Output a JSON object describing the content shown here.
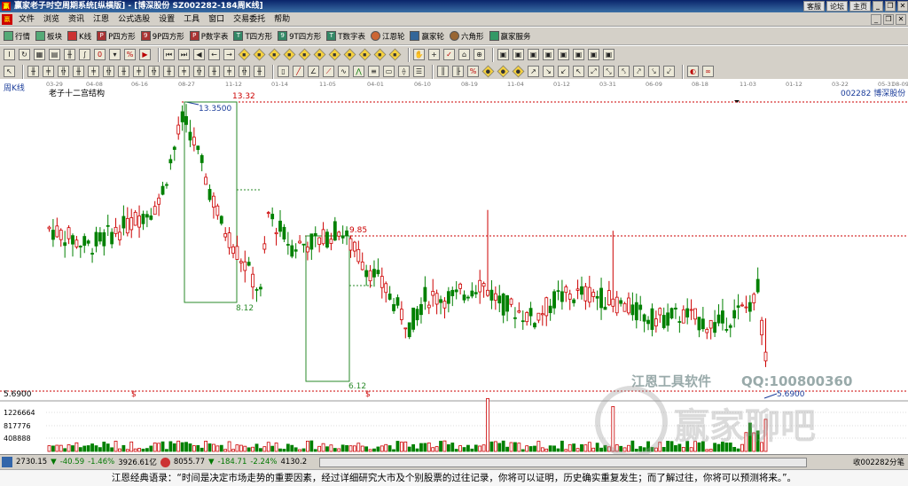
{
  "titlebar": {
    "app_logo": "赢",
    "title": "赢家老子时空周期系统[纵横版] - [博深股份  SZ002282-184周K线]",
    "links": [
      "客服",
      "论坛",
      "主页"
    ]
  },
  "menu": {
    "logo": "赢",
    "items": [
      "文件",
      "浏览",
      "资讯",
      "江恩",
      "公式选股",
      "设置",
      "工具",
      "窗口",
      "交易委托",
      "帮助"
    ]
  },
  "toolbar1": [
    {
      "icon": "grid-icon",
      "label": "行情"
    },
    {
      "icon": "blocks-icon",
      "label": "板块"
    },
    {
      "icon": "candle-icon",
      "label": "K线"
    },
    {
      "icon": "p-square-icon",
      "label": "P四方形"
    },
    {
      "icon": "9p-square-icon",
      "label": "9P四方形"
    },
    {
      "icon": "pn-square-icon",
      "label": "P数字表"
    },
    {
      "icon": "t-square-icon",
      "label": "T四方形"
    },
    {
      "icon": "9t-square-icon",
      "label": "9T四方形"
    },
    {
      "icon": "tn-square-icon",
      "label": "T数字表"
    },
    {
      "icon": "gann-wheel-icon",
      "label": "江恩轮"
    },
    {
      "icon": "winner-wheel-icon",
      "label": "赢家轮"
    },
    {
      "icon": "hexagon-icon",
      "label": "六角形"
    },
    {
      "icon": "service-icon",
      "label": "赢家服务"
    }
  ],
  "chart_header": {
    "period": "周K线",
    "structure_label": "老子十二宫结构",
    "stock_label": "002282 博深股份"
  },
  "date_ticks": [
    "03-29",
    "04-08",
    "06-16",
    "08-27",
    "11-12",
    "01-14",
    "11-05",
    "04-01",
    "06-10",
    "08-19",
    "11-04",
    "01-12",
    "03-31",
    "06-09",
    "08-18",
    "11-03",
    "01-12",
    "03-22",
    "05-31",
    "08-09"
  ],
  "price_labels": {
    "top_red": "13.32",
    "high": "13.3500",
    "mid_red": "9.85",
    "low1": "8.12",
    "low2": "6.12",
    "current_low": "5.6900",
    "left_axis": "5.6900"
  },
  "volume_axis": [
    "1226664",
    "817776",
    "408888"
  ],
  "watermark": {
    "tool": "江恩工具软件",
    "qq": "QQ:100800360",
    "brand": "赢家聊吧"
  },
  "status": {
    "sh_index": "2730.15",
    "sh_change": "-40.59",
    "sh_pct": "-1.46%",
    "sh_amount": "3926.61亿",
    "sz_index": "8055.77",
    "sz_change": "-184.71",
    "sz_pct": "-2.24%",
    "sz_amount": "4130.2",
    "right": "收002282分笔"
  },
  "quote": "江恩经典语录：“时间是决定市场走势的重要因素，经过详细研究大市及个别股票的过往记录，你将可以证明，历史确实重复发生；而了解过往，你将可以预测将来。”。",
  "chart_data": {
    "type": "candlestick",
    "title": "老子十二宫结构",
    "xlabel": "",
    "ylabel": "",
    "ylim": [
      5.6,
      13.6
    ],
    "candles_count": 184,
    "key_prices": {
      "high": 13.35,
      "resist1": 13.32,
      "resist2": 9.85,
      "support1": 8.12,
      "support2": 6.12,
      "last_low": 5.69
    },
    "up_color": "#cc0000",
    "down_color": "#008000"
  }
}
